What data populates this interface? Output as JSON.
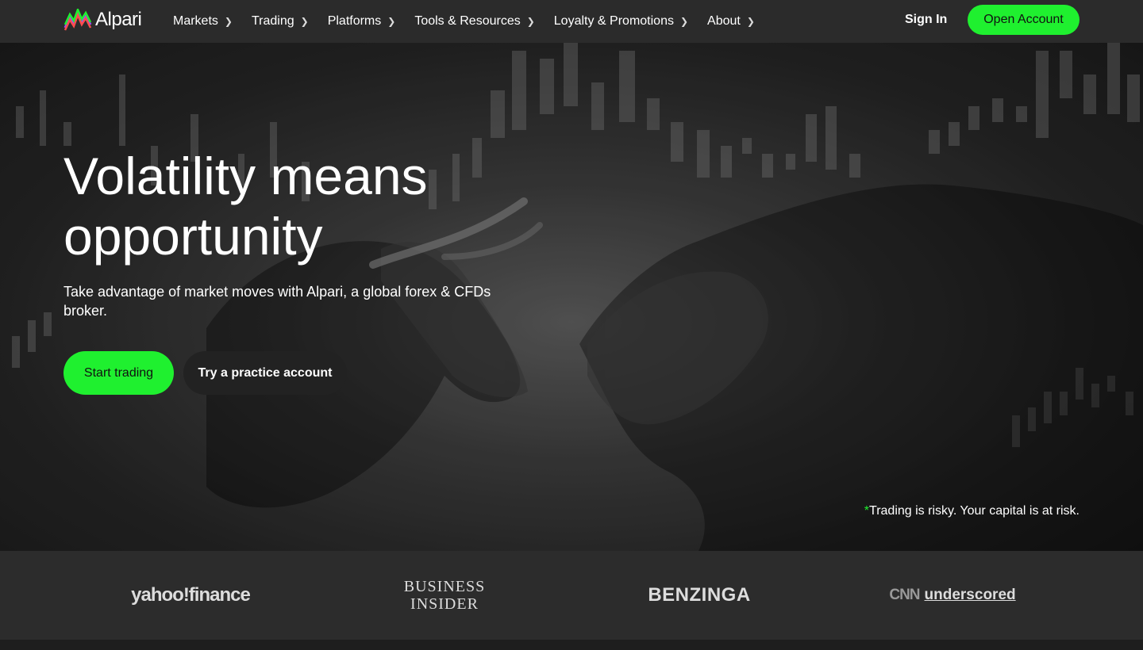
{
  "header": {
    "logo_text": "Alpari",
    "logo_icon": "alpari-chart-logo",
    "nav": [
      {
        "label": "Markets"
      },
      {
        "label": "Trading"
      },
      {
        "label": "Platforms"
      },
      {
        "label": "Tools & Resources"
      },
      {
        "label": "Loyalty & Promotions"
      },
      {
        "label": "About"
      }
    ],
    "sign_in": "Sign In",
    "open_account": "Open Account"
  },
  "hero": {
    "headline_line1": "Volatility means",
    "headline_line2": "opportunity",
    "subtext": "Take advantage of market moves with Alpari, a global forex & CFDs broker.",
    "start_trading": "Start trading",
    "practice": "Try a practice account",
    "risk_star": "*",
    "risk_text": "Trading is risky. Your capital is at risk."
  },
  "press": {
    "yahoo": "yahoo!finance",
    "bi_line1": "BUSINESS",
    "bi_line2": "INSIDER",
    "benzinga": "BENZINGA",
    "cnn_mark": "CNN",
    "cnn_text": "underscored"
  },
  "colors": {
    "accent": "#1ff02f",
    "header_bg": "#2b2b2b",
    "press_bg": "#2c2c2c"
  }
}
